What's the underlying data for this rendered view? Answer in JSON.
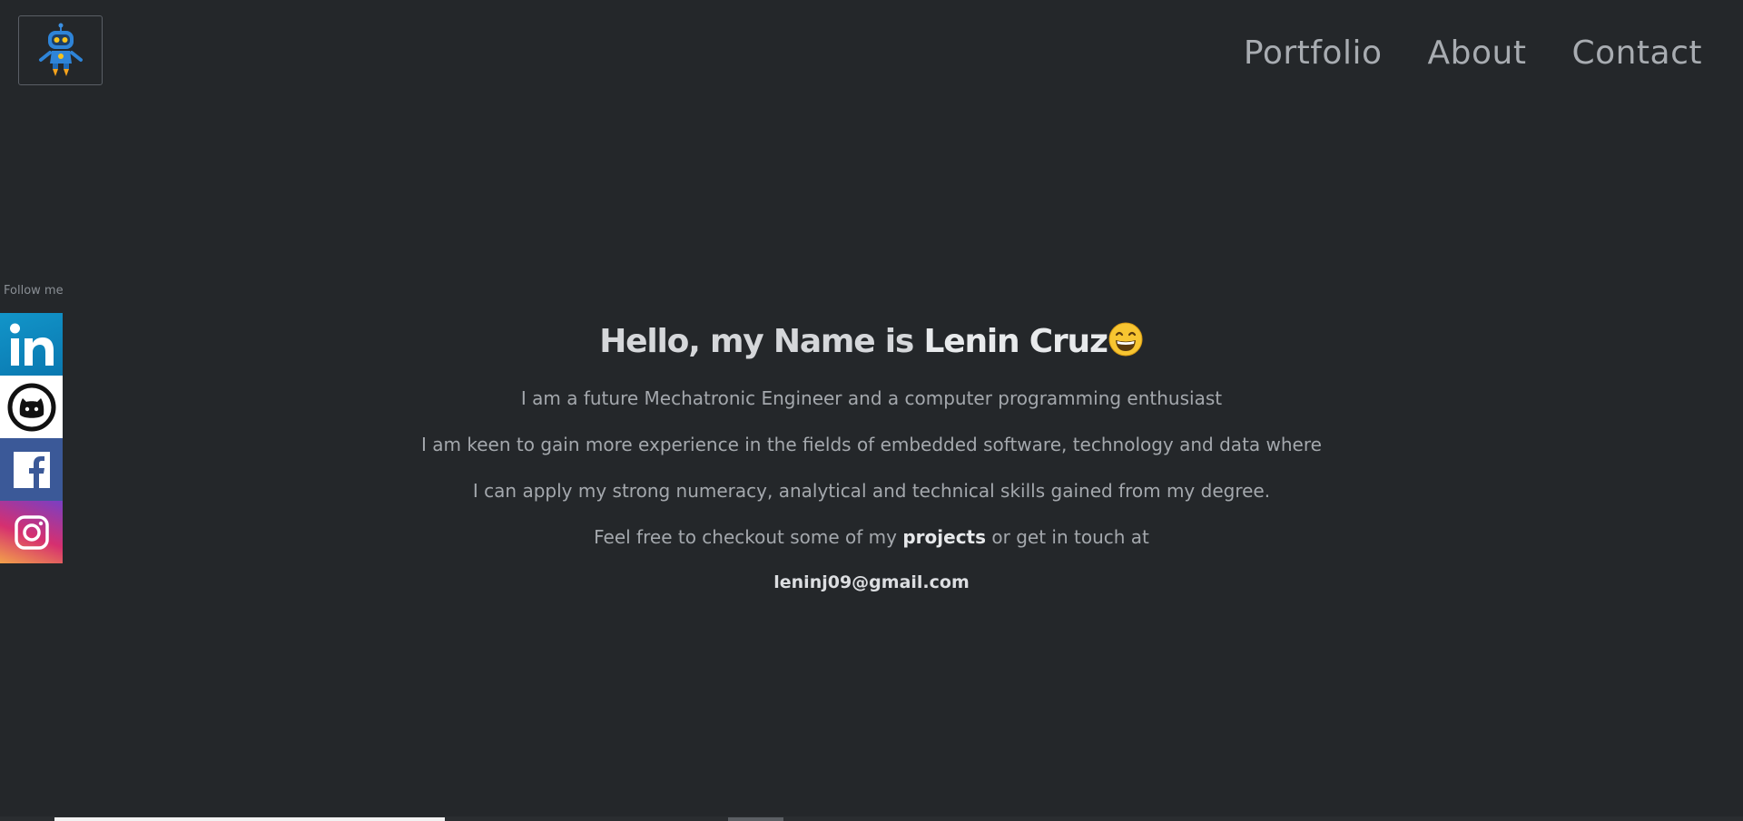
{
  "header": {
    "logo_icon": "robot-icon",
    "nav": [
      {
        "label": "Portfolio"
      },
      {
        "label": "About"
      },
      {
        "label": "Contact"
      }
    ]
  },
  "sidebar": {
    "follow_label": "Follow me",
    "socials": [
      {
        "icon": "linkedin-icon",
        "color": "#0e76a8"
      },
      {
        "icon": "github-icon",
        "color": "#ffffff"
      },
      {
        "icon": "facebook-icon",
        "color": "#3b5998"
      },
      {
        "icon": "instagram-icon",
        "color": "#d6306f"
      }
    ]
  },
  "hero": {
    "title_prefix": "Hello, my Name is ",
    "title_name": "Lenin Cruz",
    "title_emoji": "grinning-face-icon",
    "line1": "I am a future Mechatronic Engineer and a computer programming enthusiast",
    "line2": "I am keen to gain more experience in the fields of embedded software, technology and data where",
    "line3": "I can apply my strong numeracy, analytical and technical skills gained from my degree.",
    "line4_before": "Feel free to checkout some of my ",
    "line4_link": "projects",
    "line4_after": " or get in touch at",
    "email": "leninj09@gmail.com"
  },
  "colors": {
    "background": "#24272a",
    "nav_text": "#a8acb1",
    "body_text": "#a4a8ad"
  }
}
